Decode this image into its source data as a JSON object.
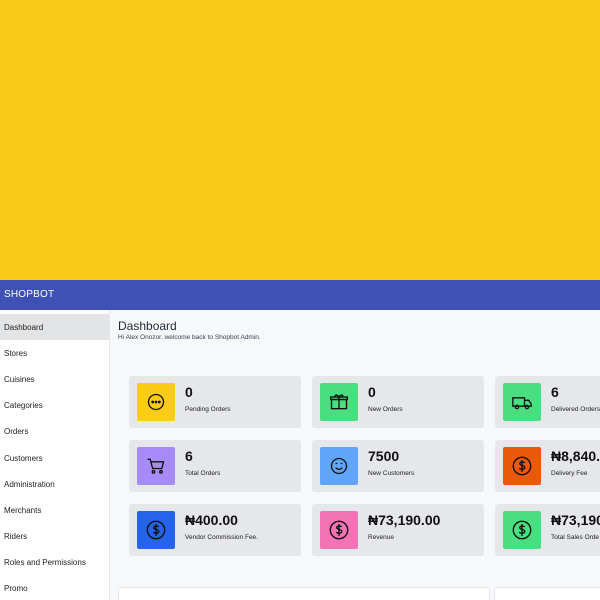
{
  "appbar": {
    "title": "SHOPBOT"
  },
  "sidebar": {
    "items": [
      {
        "label": "Dashboard",
        "name": "sidebar-item-dashboard",
        "active": true
      },
      {
        "label": "Stores",
        "name": "sidebar-item-stores"
      },
      {
        "label": "Cuisines",
        "name": "sidebar-item-cuisines"
      },
      {
        "label": "Categories",
        "name": "sidebar-item-categories"
      },
      {
        "label": "Orders",
        "name": "sidebar-item-orders"
      },
      {
        "label": "Customers",
        "name": "sidebar-item-customers"
      },
      {
        "label": "Administration",
        "name": "sidebar-item-administration"
      },
      {
        "label": "Merchants",
        "name": "sidebar-item-merchants"
      },
      {
        "label": "Riders",
        "name": "sidebar-item-riders"
      },
      {
        "label": "Roles and Permissions",
        "name": "sidebar-item-roles-and-permissions"
      },
      {
        "label": "Promo",
        "name": "sidebar-item-promo"
      }
    ]
  },
  "header": {
    "title": "Dashboard",
    "subtitle": "Hi Alex Onozor. welcome back to Shopbot Admin."
  },
  "cards": [
    {
      "value": "0",
      "label": "Pending Orders",
      "icon": "more-horizontal-icon",
      "color": "#facc15"
    },
    {
      "value": "0",
      "label": "New Orders",
      "icon": "gift-box-icon",
      "color": "#4ade80"
    },
    {
      "value": "6",
      "label": "Delivered Orders",
      "icon": "delivery-van-icon",
      "color": "#4ade80"
    },
    {
      "value": "6",
      "label": "Total Orders",
      "icon": "shopping-cart-icon",
      "color": "#a78bfa"
    },
    {
      "value": "7500",
      "label": "New Customers",
      "icon": "smile-face-icon",
      "color": "#60a5fa"
    },
    {
      "value": "₦8,840.",
      "label": "Delivery Fee",
      "icon": "dollar-circle-icon",
      "color": "#ea580c"
    },
    {
      "value": "₦400.00",
      "label": "Vendor Commission Fee.",
      "icon": "dollar-circle-icon",
      "color": "#2563eb"
    },
    {
      "value": "₦73,190.00",
      "label": "Revenue",
      "icon": "dollar-circle-icon",
      "color": "#f472b6"
    },
    {
      "value": "₦73,190",
      "label": "Total Sales Orde",
      "icon": "dollar-circle-icon",
      "color": "#4ade80"
    }
  ]
}
